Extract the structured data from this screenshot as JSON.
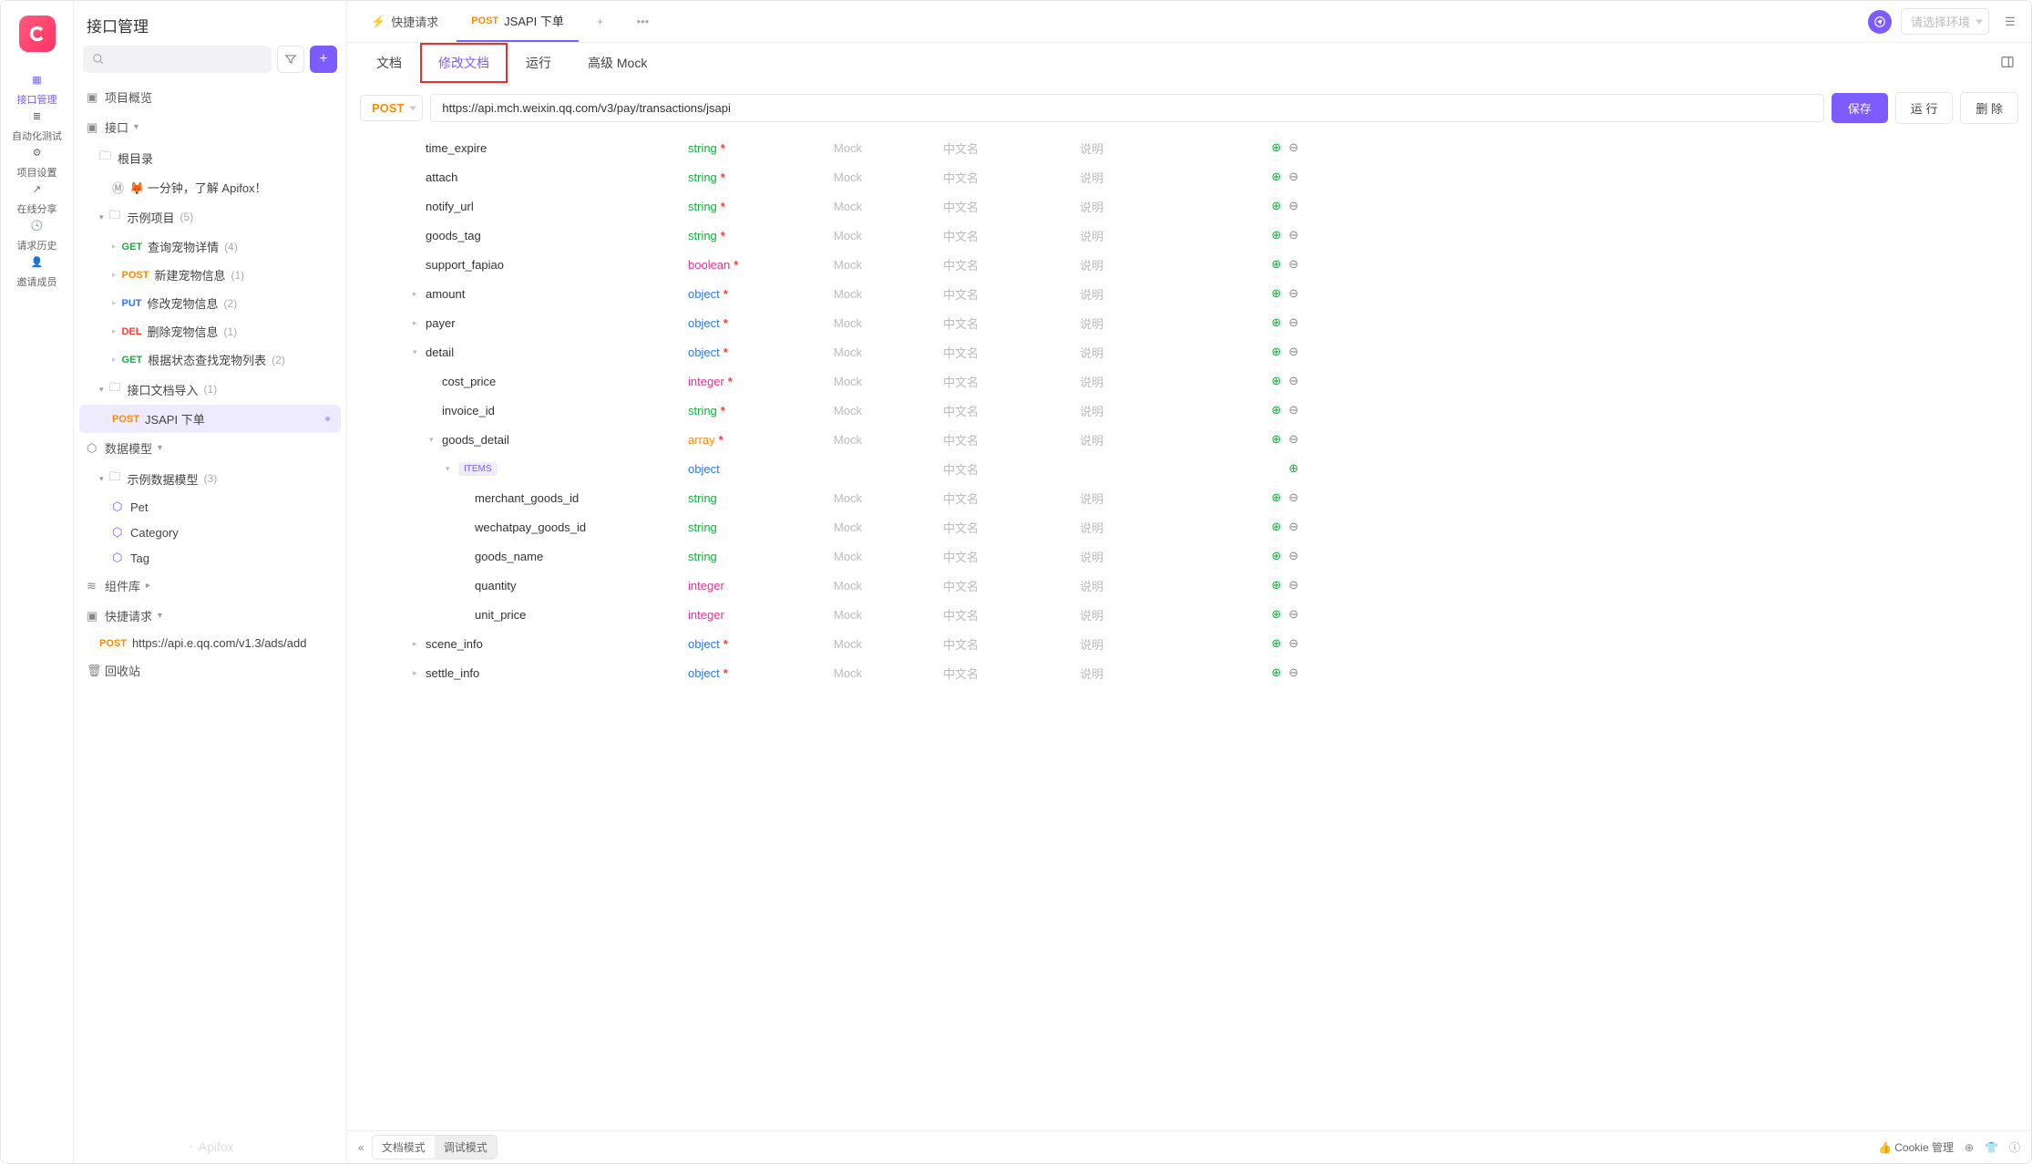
{
  "rail": {
    "items": [
      {
        "label": "接口管理",
        "active": true
      },
      {
        "label": "自动化测试"
      },
      {
        "label": "项目设置"
      },
      {
        "label": "在线分享"
      },
      {
        "label": "请求历史"
      },
      {
        "label": "邀请成员"
      }
    ]
  },
  "sidebar": {
    "title": "接口管理",
    "overview": "项目概览",
    "api_root": "接口",
    "root_dir": "根目录",
    "quickstart": "🦊 一分钟，了解 Apifox！",
    "example_proj": "示例项目",
    "example_proj_count": "(5)",
    "api_items": [
      {
        "method": "GET",
        "label": "查询宠物详情",
        "count": "(4)"
      },
      {
        "method": "POST",
        "label": "新建宠物信息",
        "count": "(1)"
      },
      {
        "method": "PUT",
        "label": "修改宠物信息",
        "count": "(2)"
      },
      {
        "method": "DEL",
        "label": "删除宠物信息",
        "count": "(1)"
      },
      {
        "method": "GET",
        "label": "根据状态查找宠物列表",
        "count": "(2)"
      }
    ],
    "import_folder": "接口文档导入",
    "import_folder_count": "(1)",
    "jsapi_item": {
      "method": "POST",
      "label": "JSAPI 下单"
    },
    "data_model": "数据模型",
    "example_model": "示例数据模型",
    "example_model_count": "(3)",
    "models": [
      "Pet",
      "Category",
      "Tag"
    ],
    "components": "组件库",
    "quick_request": "快捷请求",
    "quick_request_item": {
      "method": "POST",
      "label": "https://api.e.qq.com/v1.3/ads/add"
    },
    "recycle": "回收站",
    "watermark": "Apifox"
  },
  "tabs": {
    "quick": "快捷请求",
    "current": {
      "method": "POST",
      "label": "JSAPI 下单"
    },
    "env_placeholder": "请选择环境"
  },
  "subtabs": [
    "文档",
    "修改文档",
    "运行",
    "高级 Mock"
  ],
  "url_row": {
    "method": "POST",
    "url": "https://api.mch.weixin.qq.com/v3/pay/transactions/jsapi",
    "save": "保存",
    "run": "运 行",
    "delete": "删 除"
  },
  "columns": {
    "mock": "Mock",
    "cn": "中文名",
    "desc": "说明"
  },
  "params": [
    {
      "indent": 1,
      "name": "time_expire",
      "type": "string",
      "required": true
    },
    {
      "indent": 1,
      "name": "attach",
      "type": "string",
      "required": true
    },
    {
      "indent": 1,
      "name": "notify_url",
      "type": "string",
      "required": true
    },
    {
      "indent": 1,
      "name": "goods_tag",
      "type": "string",
      "required": true
    },
    {
      "indent": 1,
      "name": "support_fapiao",
      "type": "boolean",
      "required": true
    },
    {
      "indent": 1,
      "name": "amount",
      "type": "object",
      "required": true,
      "expandable": true
    },
    {
      "indent": 1,
      "name": "payer",
      "type": "object",
      "required": true,
      "expandable": true
    },
    {
      "indent": 1,
      "name": "detail",
      "type": "object",
      "required": true,
      "expandable": true,
      "expanded": true
    },
    {
      "indent": 2,
      "name": "cost_price",
      "type": "integer",
      "required": true
    },
    {
      "indent": 2,
      "name": "invoice_id",
      "type": "string",
      "required": true
    },
    {
      "indent": 2,
      "name": "goods_detail",
      "type": "array",
      "required": true,
      "expandable": true,
      "expanded": true
    },
    {
      "indent": 3,
      "name": "ITEMS",
      "type": "object",
      "items_badge": true,
      "no_del": true,
      "expandable": true,
      "expanded": true
    },
    {
      "indent": 4,
      "name": "merchant_goods_id",
      "type": "string"
    },
    {
      "indent": 4,
      "name": "wechatpay_goods_id",
      "type": "string"
    },
    {
      "indent": 4,
      "name": "goods_name",
      "type": "string"
    },
    {
      "indent": 4,
      "name": "quantity",
      "type": "integer"
    },
    {
      "indent": 4,
      "name": "unit_price",
      "type": "integer"
    },
    {
      "indent": 1,
      "name": "scene_info",
      "type": "object",
      "required": true,
      "expandable": true
    },
    {
      "indent": 1,
      "name": "settle_info",
      "type": "object",
      "required": true,
      "expandable": true
    }
  ],
  "footer": {
    "doc_mode": "文档模式",
    "debug_mode": "调试模式",
    "cookie": "Cookie 管理"
  }
}
